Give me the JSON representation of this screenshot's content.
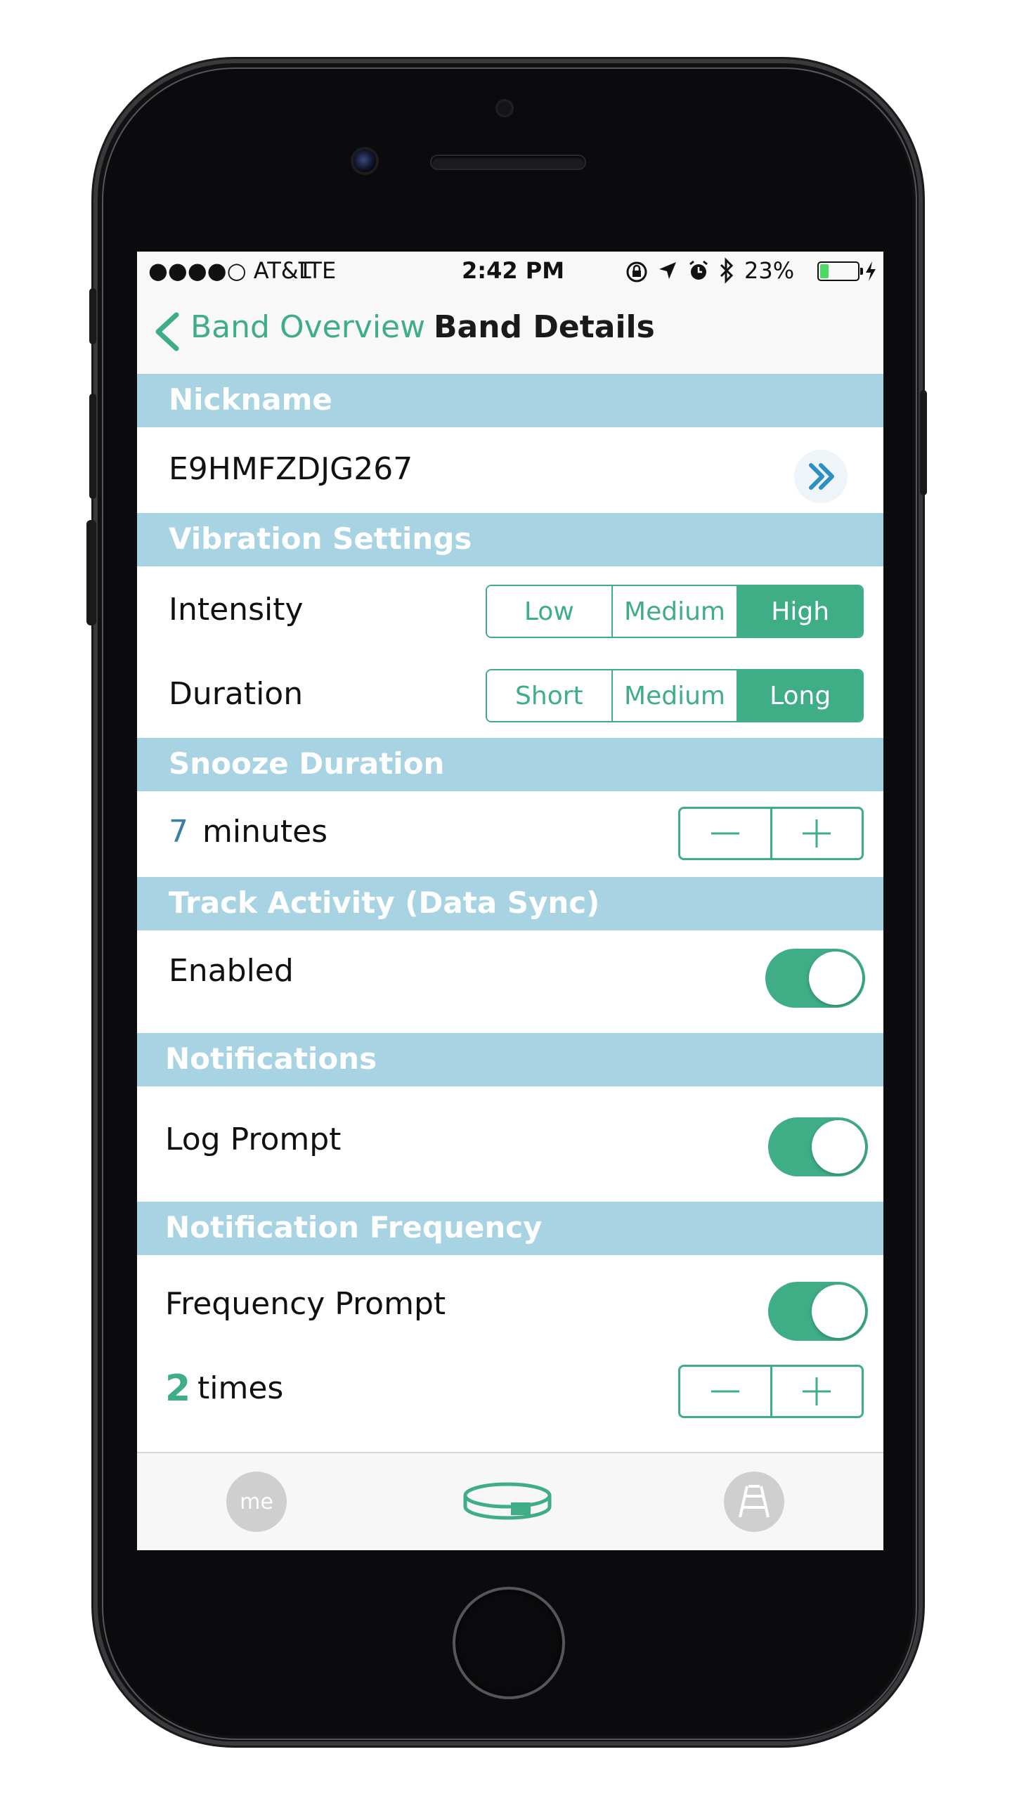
{
  "status_bar": {
    "carrier": "●●●●○ AT&T",
    "network": "LTE",
    "time": "2:42 PM",
    "battery_percent": "23%",
    "battery_level": 0.23,
    "icons": [
      "orientation-lock-icon",
      "location-arrow-icon",
      "alarm-icon",
      "bluetooth-icon",
      "battery-icon",
      "charging-icon"
    ]
  },
  "nav": {
    "back_label": "Band Overview",
    "title": "Band Details"
  },
  "sections": {
    "nickname": {
      "header": "Nickname",
      "value": "E9HMFZDJG267"
    },
    "vibration": {
      "header": "Vibration Settings",
      "intensity": {
        "label": "Intensity",
        "options": [
          "Low",
          "Medium",
          "High"
        ],
        "selected": "High"
      },
      "duration": {
        "label": "Duration",
        "options": [
          "Short",
          "Medium",
          "Long"
        ],
        "selected": "Long"
      }
    },
    "snooze": {
      "header": "Snooze Duration",
      "value": "7",
      "unit": "minutes"
    },
    "track_activity": {
      "header": "Track Activity (Data Sync)",
      "label": "Enabled",
      "on": true
    },
    "notifications": {
      "header": "Notifications",
      "label": "Log Prompt",
      "on": true
    },
    "frequency": {
      "header": "Notification Frequency",
      "label": "Frequency Prompt",
      "on": true,
      "count": "2",
      "count_unit": "times"
    }
  },
  "tab_bar": {
    "me_label": "me",
    "items": [
      "me-tab",
      "band-tab",
      "coach-tab"
    ],
    "selected": "band-tab"
  },
  "colors": {
    "accent": "#3fae86",
    "section_header": "#a7d3e3",
    "value_blue": "#3a7fa6"
  }
}
